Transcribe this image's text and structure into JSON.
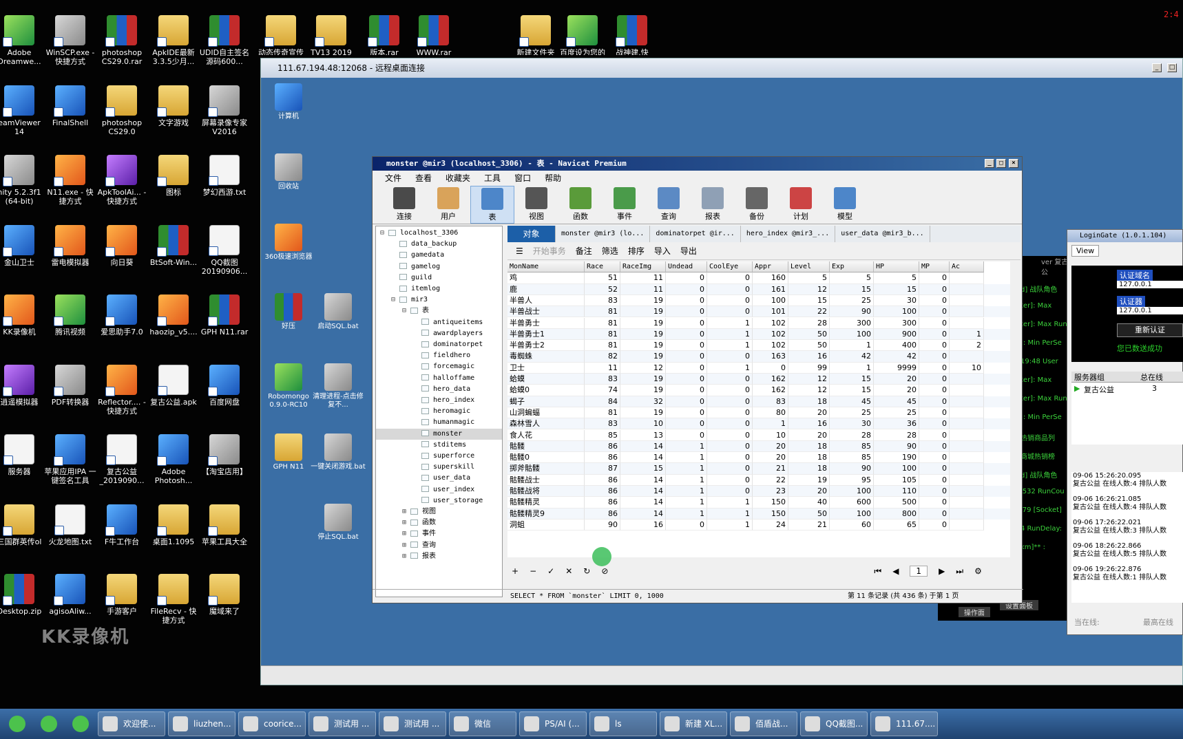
{
  "desktop_icons": [
    {
      "label": "Adobe Dreamwe...",
      "cls": "app3"
    },
    {
      "label": "WinSCP.exe - 快捷方式",
      "cls": "app4"
    },
    {
      "label": "photoshop CS29.0.rar",
      "cls": "rar"
    },
    {
      "label": "ApkIDE最新 3.3.5少月...",
      "cls": "fold"
    },
    {
      "label": "UDID自主签名源码600...",
      "cls": "rar"
    },
    {
      "label": "eamViewer 14",
      "cls": "app"
    },
    {
      "label": "FinalShell",
      "cls": "app"
    },
    {
      "label": "photoshop CS29.0",
      "cls": "fold"
    },
    {
      "label": "文字游戏",
      "cls": "fold"
    },
    {
      "label": "屏幕录像专家 V2016",
      "cls": "app4"
    },
    {
      "label": "nity 5.2.3f1 (64-bit)",
      "cls": "app4"
    },
    {
      "label": "N11.exe - 快捷方式",
      "cls": "app2"
    },
    {
      "label": "ApkToolAi... - 快捷方式",
      "cls": "app5"
    },
    {
      "label": "图标",
      "cls": "fold"
    },
    {
      "label": "梦幻西游.txt",
      "cls": "doc"
    },
    {
      "label": "金山卫士",
      "cls": "app"
    },
    {
      "label": "雷电模拟器",
      "cls": "app2"
    },
    {
      "label": "向日葵",
      "cls": "app2"
    },
    {
      "label": "BtSoft-Win...",
      "cls": "rar"
    },
    {
      "label": "QQ截图 20190906...",
      "cls": "doc"
    },
    {
      "label": "KK录像机",
      "cls": "app2"
    },
    {
      "label": "腾讯视频",
      "cls": "app3"
    },
    {
      "label": "爱思助手7.0",
      "cls": "app"
    },
    {
      "label": "haozip_v5....",
      "cls": "app2"
    },
    {
      "label": "GPH N11.rar",
      "cls": "rar"
    },
    {
      "label": "逍遥模拟器",
      "cls": "app5"
    },
    {
      "label": "PDF转换器",
      "cls": "app4"
    },
    {
      "label": "Reflector.... - 快捷方式",
      "cls": "app2"
    },
    {
      "label": "复古公益.apk",
      "cls": "doc"
    },
    {
      "label": "百度网盘",
      "cls": "app"
    },
    {
      "label": "服务器",
      "cls": "doc"
    },
    {
      "label": "苹果应用IPA 一键签名工具",
      "cls": "app"
    },
    {
      "label": "复古公益 _2019090...",
      "cls": "doc"
    },
    {
      "label": "Adobe Photosh...",
      "cls": "app"
    },
    {
      "label": "【淘宝店用】",
      "cls": "app4"
    },
    {
      "label": "三国群英传ol",
      "cls": "fold"
    },
    {
      "label": "火龙地图.txt",
      "cls": "doc"
    },
    {
      "label": "F牛工作台",
      "cls": "app"
    },
    {
      "label": "桌面1.1095",
      "cls": "fold"
    },
    {
      "label": "苹果工具大全",
      "cls": "fold"
    },
    {
      "label": "Desktop.zip",
      "cls": "rar"
    },
    {
      "label": "agisoAliw...",
      "cls": "app"
    },
    {
      "label": "手游客户",
      "cls": "fold"
    },
    {
      "label": "FileRecv - 快捷方式",
      "cls": "fold"
    },
    {
      "label": "魔域来了",
      "cls": "fold"
    }
  ],
  "top_icons": [
    {
      "label": "动态传奇宣传",
      "cls": "fold"
    },
    {
      "label": "TV13 2019",
      "cls": "fold"
    },
    {
      "label": "版本.rar",
      "cls": "rar"
    },
    {
      "label": "WWW.rar",
      "cls": "rar"
    },
    {
      "label": "新建文件夹",
      "cls": "fold"
    },
    {
      "label": "百度设为您的",
      "cls": "app3"
    },
    {
      "label": "战神建.快",
      "cls": "rar"
    }
  ],
  "watermark": "KK录像机",
  "clock": "2:4",
  "rdp": {
    "title": "111.67.194.48:12068 - 远程桌面连接",
    "icons": [
      {
        "label": "计算机",
        "cls": "app"
      },
      {
        "label": "回收站",
        "cls": "app4"
      },
      {
        "label": "360极速浏览器",
        "cls": "app2"
      },
      {
        "label": "好压",
        "cls": "rar"
      },
      {
        "label": "启动SQL.bat",
        "cls": "app4"
      },
      {
        "label": "Robomongo 0.9.0-RC10",
        "cls": "app3"
      },
      {
        "label": "清理进程-点击修复不...",
        "cls": "app4"
      },
      {
        "label": "GPH N11",
        "cls": "fold"
      },
      {
        "label": "一键关闭游戏.bat",
        "cls": "app4"
      },
      {
        "label": "停止SQL.bat",
        "cls": "app4"
      }
    ]
  },
  "navicat": {
    "title": "monster @mir3 (localhost_3306) - 表 - Navicat Premium",
    "menu": [
      "文件",
      "查看",
      "收藏夹",
      "工具",
      "窗口",
      "帮助"
    ],
    "toolbar": [
      {
        "label": "连接",
        "color": "#4a4a4a"
      },
      {
        "label": "用户",
        "color": "#d9a35a"
      },
      {
        "label": "表",
        "color": "#4d86c9"
      },
      {
        "label": "视图",
        "color": "#555"
      },
      {
        "label": "函数",
        "color": "#5a9b3a"
      },
      {
        "label": "事件",
        "color": "#4a9b4a"
      },
      {
        "label": "查询",
        "color": "#5c8ac4"
      },
      {
        "label": "报表",
        "color": "#8fa0b5"
      },
      {
        "label": "备份",
        "color": "#666"
      },
      {
        "label": "计划",
        "color": "#c44"
      },
      {
        "label": "模型",
        "color": "#4d86c9"
      }
    ],
    "tree": [
      {
        "label": "localhost_3306",
        "lvl": 0,
        "exp": "⊟"
      },
      {
        "label": "data_backup",
        "lvl": 1
      },
      {
        "label": "gamedata",
        "lvl": 1
      },
      {
        "label": "gamelog",
        "lvl": 1
      },
      {
        "label": "guild",
        "lvl": 1
      },
      {
        "label": "itemlog",
        "lvl": 1
      },
      {
        "label": "mir3",
        "lvl": 1,
        "exp": "⊟"
      },
      {
        "label": "表",
        "lvl": 2,
        "exp": "⊟"
      },
      {
        "label": "antiqueitems",
        "lvl": 3
      },
      {
        "label": "awardplayers",
        "lvl": 3
      },
      {
        "label": "dominatorpet",
        "lvl": 3
      },
      {
        "label": "fieldhero",
        "lvl": 3
      },
      {
        "label": "forcemagic",
        "lvl": 3
      },
      {
        "label": "halloffame",
        "lvl": 3
      },
      {
        "label": "hero_data",
        "lvl": 3
      },
      {
        "label": "hero_index",
        "lvl": 3
      },
      {
        "label": "heromagic",
        "lvl": 3
      },
      {
        "label": "humanmagic",
        "lvl": 3
      },
      {
        "label": "monster",
        "lvl": 3,
        "sel": true
      },
      {
        "label": "stditems",
        "lvl": 3
      },
      {
        "label": "superforce",
        "lvl": 3
      },
      {
        "label": "superskill",
        "lvl": 3
      },
      {
        "label": "user_data",
        "lvl": 3
      },
      {
        "label": "user_index",
        "lvl": 3
      },
      {
        "label": "user_storage",
        "lvl": 3
      },
      {
        "label": "视图",
        "lvl": 2,
        "exp": "⊞"
      },
      {
        "label": "函数",
        "lvl": 2,
        "exp": "⊞"
      },
      {
        "label": "事件",
        "lvl": 2,
        "exp": "⊞"
      },
      {
        "label": "查询",
        "lvl": 2,
        "exp": "⊞"
      },
      {
        "label": "报表",
        "lvl": 2,
        "exp": "⊞"
      }
    ],
    "tabs": [
      "对象",
      "monster @mir3 (lo...",
      "dominatorpet @ir...",
      "hero_index @mir3_...",
      "user_data @mir3_b..."
    ],
    "subtoolbar": {
      "begin_tx": "开始事务",
      "memo": "备注",
      "filter": "筛选",
      "sort": "排序",
      "import": "导入",
      "export": "导出"
    },
    "columns": [
      "MonName",
      "Race",
      "RaceImg",
      "Undead",
      "CoolEye",
      "Appr",
      "Level",
      "Exp",
      "HP",
      "MP",
      "Ac"
    ],
    "rows": [
      [
        "鸡",
        "51",
        "11",
        "0",
        "0",
        "160",
        "5",
        "5",
        "5",
        "0",
        ""
      ],
      [
        "鹿",
        "52",
        "11",
        "0",
        "0",
        "161",
        "12",
        "15",
        "15",
        "0",
        ""
      ],
      [
        "半兽人",
        "83",
        "19",
        "0",
        "0",
        "100",
        "15",
        "25",
        "30",
        "0",
        ""
      ],
      [
        "半兽战士",
        "81",
        "19",
        "0",
        "0",
        "101",
        "22",
        "90",
        "100",
        "0",
        ""
      ],
      [
        "半兽勇士",
        "81",
        "19",
        "0",
        "1",
        "102",
        "28",
        "300",
        "300",
        "0",
        ""
      ],
      [
        "半兽勇士1",
        "81",
        "19",
        "0",
        "1",
        "102",
        "50",
        "100",
        "900",
        "0",
        "1"
      ],
      [
        "半兽勇士2",
        "81",
        "19",
        "0",
        "1",
        "102",
        "50",
        "1",
        "400",
        "0",
        "2"
      ],
      [
        "毒蜘蛛",
        "82",
        "19",
        "0",
        "0",
        "163",
        "16",
        "42",
        "42",
        "0",
        ""
      ],
      [
        "卫士",
        "11",
        "12",
        "0",
        "1",
        "0",
        "99",
        "1",
        "9999",
        "0",
        "10"
      ],
      [
        "蛤蟆",
        "83",
        "19",
        "0",
        "0",
        "162",
        "12",
        "15",
        "20",
        "0",
        ""
      ],
      [
        "蛤蟆0",
        "74",
        "19",
        "0",
        "0",
        "162",
        "12",
        "15",
        "20",
        "0",
        ""
      ],
      [
        "蝎子",
        "84",
        "32",
        "0",
        "0",
        "83",
        "18",
        "45",
        "45",
        "0",
        ""
      ],
      [
        "山洞蝙蝠",
        "81",
        "19",
        "0",
        "0",
        "80",
        "20",
        "25",
        "25",
        "0",
        ""
      ],
      [
        "森林雪人",
        "83",
        "10",
        "0",
        "0",
        "1",
        "16",
        "30",
        "36",
        "0",
        ""
      ],
      [
        "食人花",
        "85",
        "13",
        "0",
        "0",
        "10",
        "20",
        "28",
        "28",
        "0",
        ""
      ],
      [
        "骷髅",
        "86",
        "14",
        "1",
        "0",
        "20",
        "18",
        "85",
        "90",
        "0",
        ""
      ],
      [
        "骷髅0",
        "86",
        "14",
        "1",
        "0",
        "20",
        "18",
        "85",
        "190",
        "0",
        ""
      ],
      [
        "掷斧骷髅",
        "87",
        "15",
        "1",
        "0",
        "21",
        "18",
        "90",
        "100",
        "0",
        ""
      ],
      [
        "骷髅战士",
        "86",
        "14",
        "1",
        "0",
        "22",
        "19",
        "95",
        "105",
        "0",
        ""
      ],
      [
        "骷髅战将",
        "86",
        "14",
        "1",
        "0",
        "23",
        "20",
        "100",
        "110",
        "0",
        ""
      ],
      [
        "骷髅精灵",
        "86",
        "14",
        "1",
        "1",
        "150",
        "40",
        "600",
        "500",
        "0",
        ""
      ],
      [
        "骷髅精灵9",
        "86",
        "14",
        "1",
        "1",
        "150",
        "50",
        "100",
        "800",
        "0",
        ""
      ],
      [
        "洞蛆",
        "90",
        "16",
        "0",
        "1",
        "24",
        "21",
        "60",
        "65",
        "0",
        ""
      ]
    ],
    "page_no": "1",
    "sql": "SELECT * FROM `monster` LIMIT 0, 1000",
    "record_info": "第 11 条记录 (共 436 条) 于第 1 页"
  },
  "behind_win": {
    "title": "ver 复古公",
    "lines": [
      "d] 战队角色",
      "ter]: Max",
      "ter]: Max Run",
      "]: Min PerSe",
      "19:48 User",
      "ter]: Max",
      "ter]: Max Run",
      "]: Min PerSe",
      "热销商品列",
      "商城热销榜",
      "d] 战队角色",
      "'532 RunCou",
      "'79 [Socket]",
      "4 RunDelay:",
      "km]** :"
    ],
    "btn1": "操作面",
    "btn2": "设置面板"
  },
  "logingate": {
    "title": "LoginGate (1.0.1.104)",
    "view": "View",
    "label1": "认证域名",
    "ip1": "127.0.0.1",
    "label2": "认证器",
    "ip2": "127.0.0.1",
    "reauth": "重新认证",
    "success": "您已数送成功",
    "col1": "服务器组",
    "col2": "总在线",
    "server": "复古公益",
    "count": "3",
    "logs": [
      {
        "t": "09-06 15:26:20.095",
        "m": "复古公益 在线人数:4 排队人数"
      },
      {
        "t": "09-06 16:26:21.085",
        "m": "复古公益 在线人数:4 排队人数"
      },
      {
        "t": "09-06 17:26:22.021",
        "m": "复古公益 在线人数:3 排队人数"
      },
      {
        "t": "09-06 18:26:22.866",
        "m": "复古公益 在线人数:5 排队人数"
      },
      {
        "t": "09-06 19:26:22.876",
        "m": "复古公益 在线人数:1 排队人数"
      }
    ],
    "footer1": "当在线:",
    "footer2": "最高在线"
  },
  "taskbar": [
    {
      "label": "",
      "w": 42
    },
    {
      "label": "",
      "w": 42
    },
    {
      "label": "",
      "w": 42
    },
    {
      "label": "欢迎使...",
      "w": 98
    },
    {
      "label": "liuzhen...",
      "w": 98
    },
    {
      "label": "coorice...",
      "w": 98
    },
    {
      "label": "测试用 ...",
      "w": 98
    },
    {
      "label": "测试用 ...",
      "w": 98
    },
    {
      "label": "微信",
      "w": 98
    },
    {
      "label": "PS/AI (...",
      "w": 98
    },
    {
      "label": "ls",
      "w": 98
    },
    {
      "label": "新建 XL...",
      "w": 98
    },
    {
      "label": "佰盾战...",
      "w": 98
    },
    {
      "label": "QQ截图...",
      "w": 98
    },
    {
      "label": "111.67....",
      "w": 98
    }
  ]
}
